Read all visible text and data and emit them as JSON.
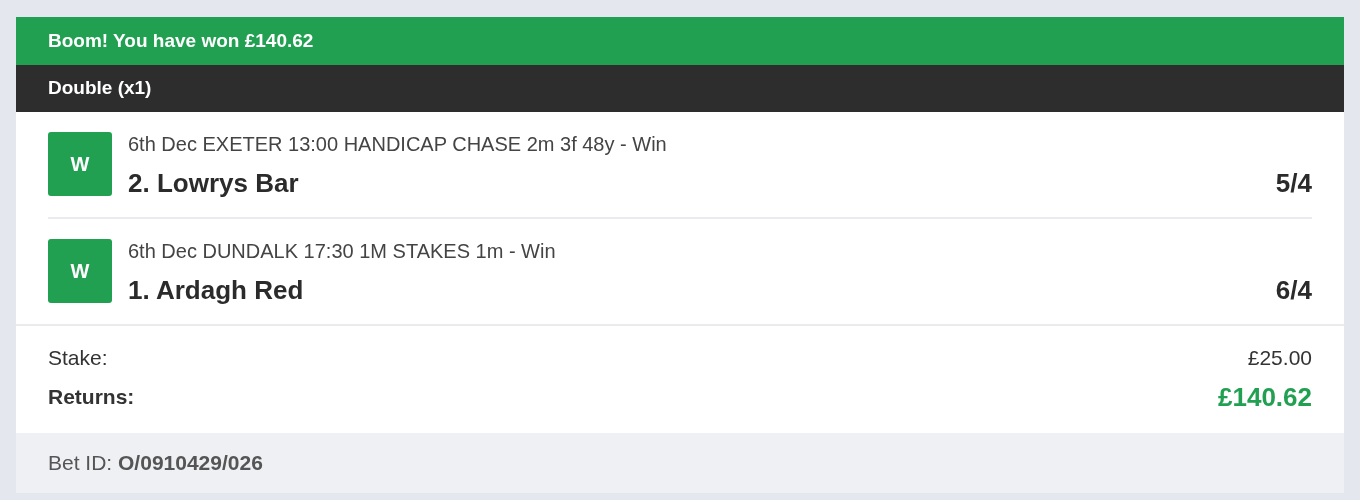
{
  "banner": {
    "text": "Boom! You have won £140.62"
  },
  "bet_type": "Double (x1)",
  "legs": [
    {
      "result": "W",
      "won": true,
      "race": "6th Dec EXETER 13:00 HANDICAP CHASE 2m 3f 48y - Win",
      "selection": "2. Lowrys Bar",
      "odds": "5/4"
    },
    {
      "result": "W",
      "won": true,
      "race": "6th Dec DUNDALK 17:30 1M STAKES 1m - Win",
      "selection": "1. Ardagh Red",
      "odds": "6/4"
    }
  ],
  "stake": {
    "label": "Stake:",
    "value": "£25.00"
  },
  "returns": {
    "label": "Returns:",
    "value": "£140.62"
  },
  "bet_id": {
    "label": "Bet ID:",
    "value": "O/0910429/026"
  }
}
